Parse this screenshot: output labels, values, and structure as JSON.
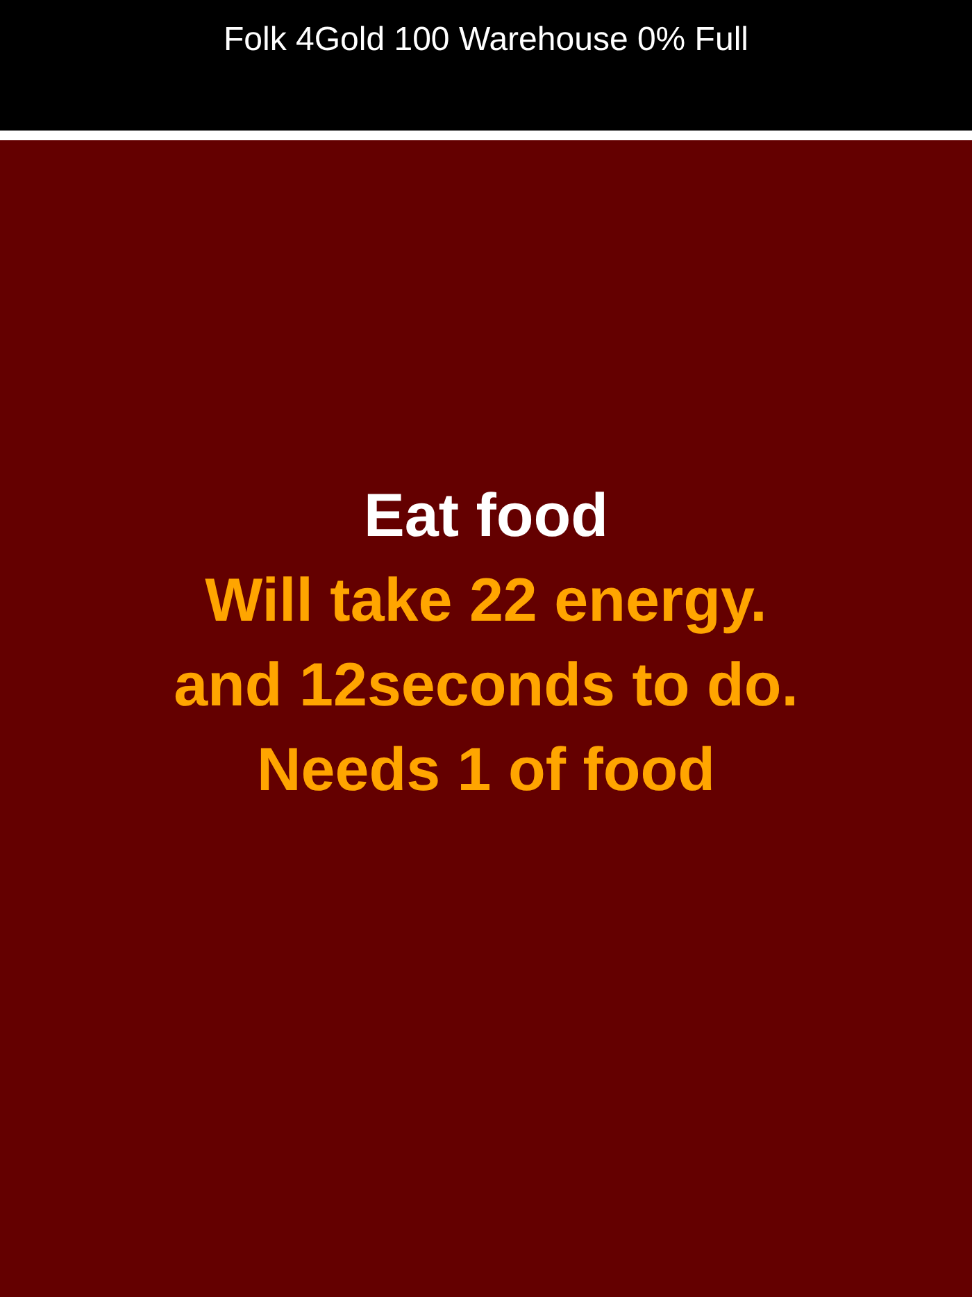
{
  "status_bar": {
    "text": "Folk 4Gold 100 Warehouse 0% Full"
  },
  "action": {
    "title": "Eat food",
    "details": [
      "Will take 22 energy.",
      "and 12seconds to do.",
      "Needs 1 of food"
    ]
  }
}
